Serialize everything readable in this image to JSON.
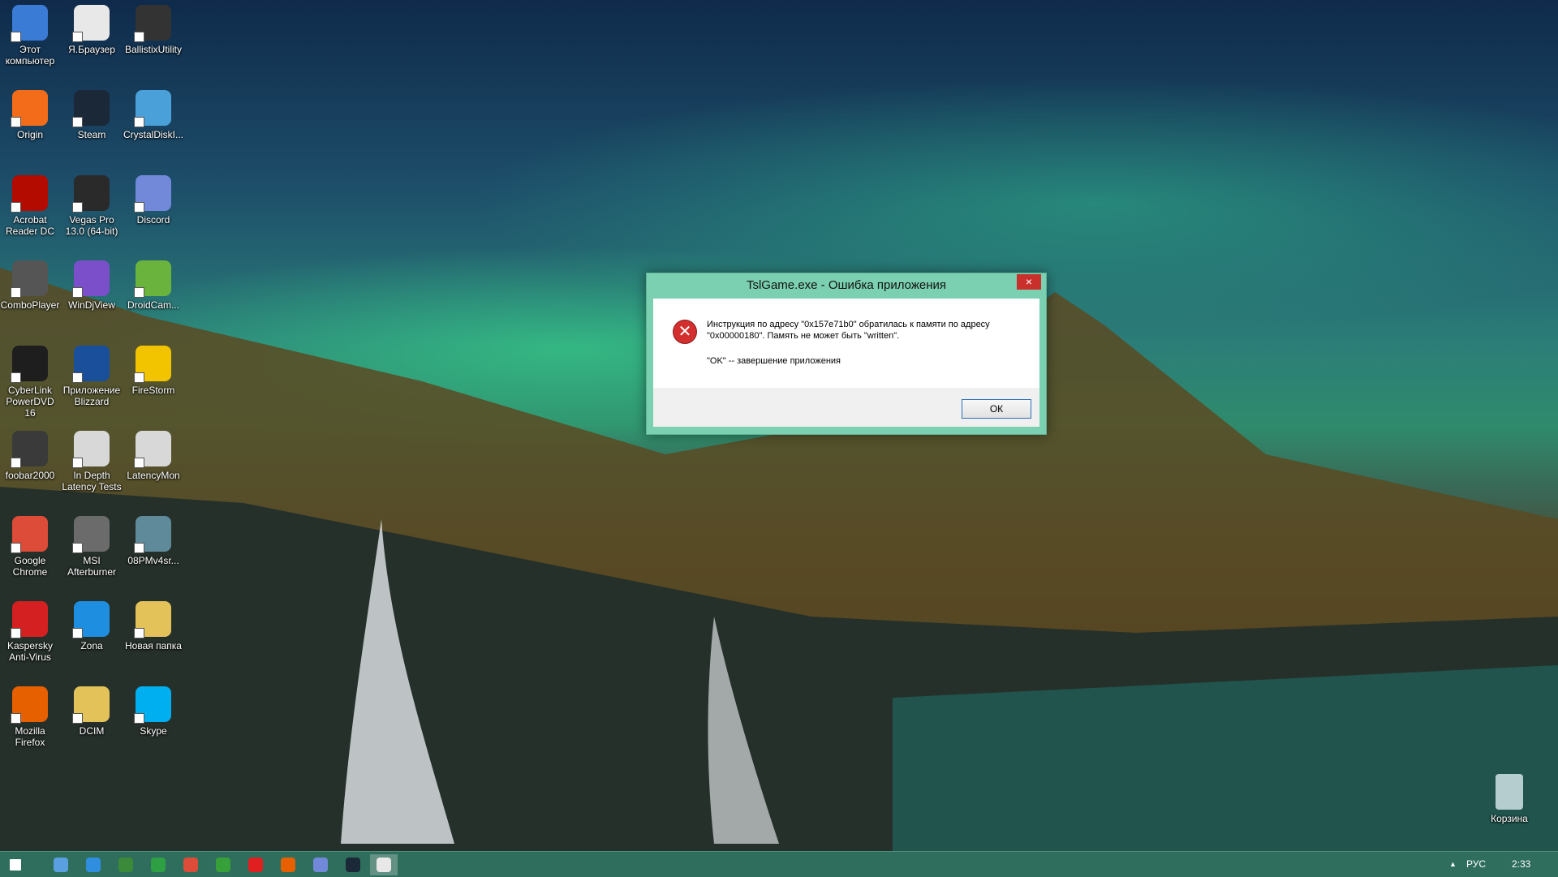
{
  "desktop_icons": [
    {
      "label": "Этот\nкомпьютер",
      "icon": "computer-icon",
      "color": "#3a7bd5"
    },
    {
      "label": "Я.Браузер",
      "icon": "yandex-browser-icon",
      "color": "#e8e8e8"
    },
    {
      "label": "BallistixUtility",
      "icon": "ballistix-icon",
      "color": "#333333"
    },
    {
      "label": "Origin",
      "icon": "origin-icon",
      "color": "#f26c1a"
    },
    {
      "label": "Steam",
      "icon": "steam-icon",
      "color": "#1b2838"
    },
    {
      "label": "CrystalDiskI...",
      "icon": "crystaldisk-icon",
      "color": "#4aa0d8"
    },
    {
      "label": "Acrobat\nReader DC",
      "icon": "acrobat-icon",
      "color": "#b30b00"
    },
    {
      "label": "Vegas Pro\n13.0 (64-bit)",
      "icon": "vegas-icon",
      "color": "#2a2a2a"
    },
    {
      "label": "Discord",
      "icon": "discord-icon",
      "color": "#7289da"
    },
    {
      "label": "ComboPlayer",
      "icon": "comboplayer-icon",
      "color": "#555555"
    },
    {
      "label": "WinDjView",
      "icon": "windjview-icon",
      "color": "#7a4fc9"
    },
    {
      "label": "DroidCam...",
      "icon": "droidcam-icon",
      "color": "#6ab43e"
    },
    {
      "label": "CyberLink\nPowerDVD 16",
      "icon": "powerdvd-icon",
      "color": "#1e1e1e"
    },
    {
      "label": "Приложение\nBlizzard",
      "icon": "blizzard-icon",
      "color": "#1a4f9c"
    },
    {
      "label": "FireStorm",
      "icon": "firestorm-icon",
      "color": "#f2c400"
    },
    {
      "label": "foobar2000",
      "icon": "foobar-icon",
      "color": "#3a3a3a"
    },
    {
      "label": "In Depth\nLatency Tests",
      "icon": "latency-tests-icon",
      "color": "#d8d8d8"
    },
    {
      "label": "LatencyMon",
      "icon": "latencymon-icon",
      "color": "#d8d8d8"
    },
    {
      "label": "Google\nChrome",
      "icon": "chrome-icon",
      "color": "#dd4b39"
    },
    {
      "label": "MSI\nAfterburner",
      "icon": "afterburner-icon",
      "color": "#6b6b6b"
    },
    {
      "label": "08PMv4sr...",
      "icon": "image-file-icon",
      "color": "#5f8a9a"
    },
    {
      "label": "Kaspersky\nAnti-Virus",
      "icon": "kaspersky-icon",
      "color": "#d42020"
    },
    {
      "label": "Zona",
      "icon": "zona-icon",
      "color": "#1e8fe0"
    },
    {
      "label": "Новая папка",
      "icon": "folder-icon",
      "color": "#e4c25a"
    },
    {
      "label": "Mozilla\nFirefox",
      "icon": "firefox-icon",
      "color": "#e66000"
    },
    {
      "label": "DCIM",
      "icon": "folder-icon",
      "color": "#e4c25a"
    },
    {
      "label": "Skype",
      "icon": "skype-icon",
      "color": "#00aff0"
    }
  ],
  "recycle_bin": {
    "label": "Корзина"
  },
  "dialog": {
    "title": "TslGame.exe - Ошибка приложения",
    "close_symbol": "×",
    "error_symbol": "✕",
    "message_line1": "Инструкция по адресу \"0x157e71b0\" обратилась к памяти по адресу",
    "message_line2": "\"0x00000180\". Память не может быть \"written\".",
    "message_line3": "\"OK\" -- завершение приложения",
    "ok_label": "ОК"
  },
  "taskbar": {
    "items": [
      {
        "icon": "windows-start-icon",
        "color": "#ffffff"
      },
      {
        "icon": "task-view-icon",
        "color": "#5aa0e0"
      },
      {
        "icon": "internet-explorer-icon",
        "color": "#2f8ee0"
      },
      {
        "icon": "kaspersky-icon",
        "color": "#3a8a3a"
      },
      {
        "icon": "store-icon",
        "color": "#2ea043"
      },
      {
        "icon": "chrome-icon",
        "color": "#dd4b39"
      },
      {
        "icon": "xbox-icon",
        "color": "#38a038"
      },
      {
        "icon": "yandex-browser-icon",
        "color": "#e02020"
      },
      {
        "icon": "firefox-icon",
        "color": "#e66000"
      },
      {
        "icon": "discord-icon",
        "color": "#7289da"
      },
      {
        "icon": "steam-icon",
        "color": "#1b2838"
      },
      {
        "icon": "app-window-icon",
        "color": "#e8e8e8"
      }
    ],
    "tray_chevron": "▲",
    "language": "РУС",
    "time": "2:33"
  }
}
